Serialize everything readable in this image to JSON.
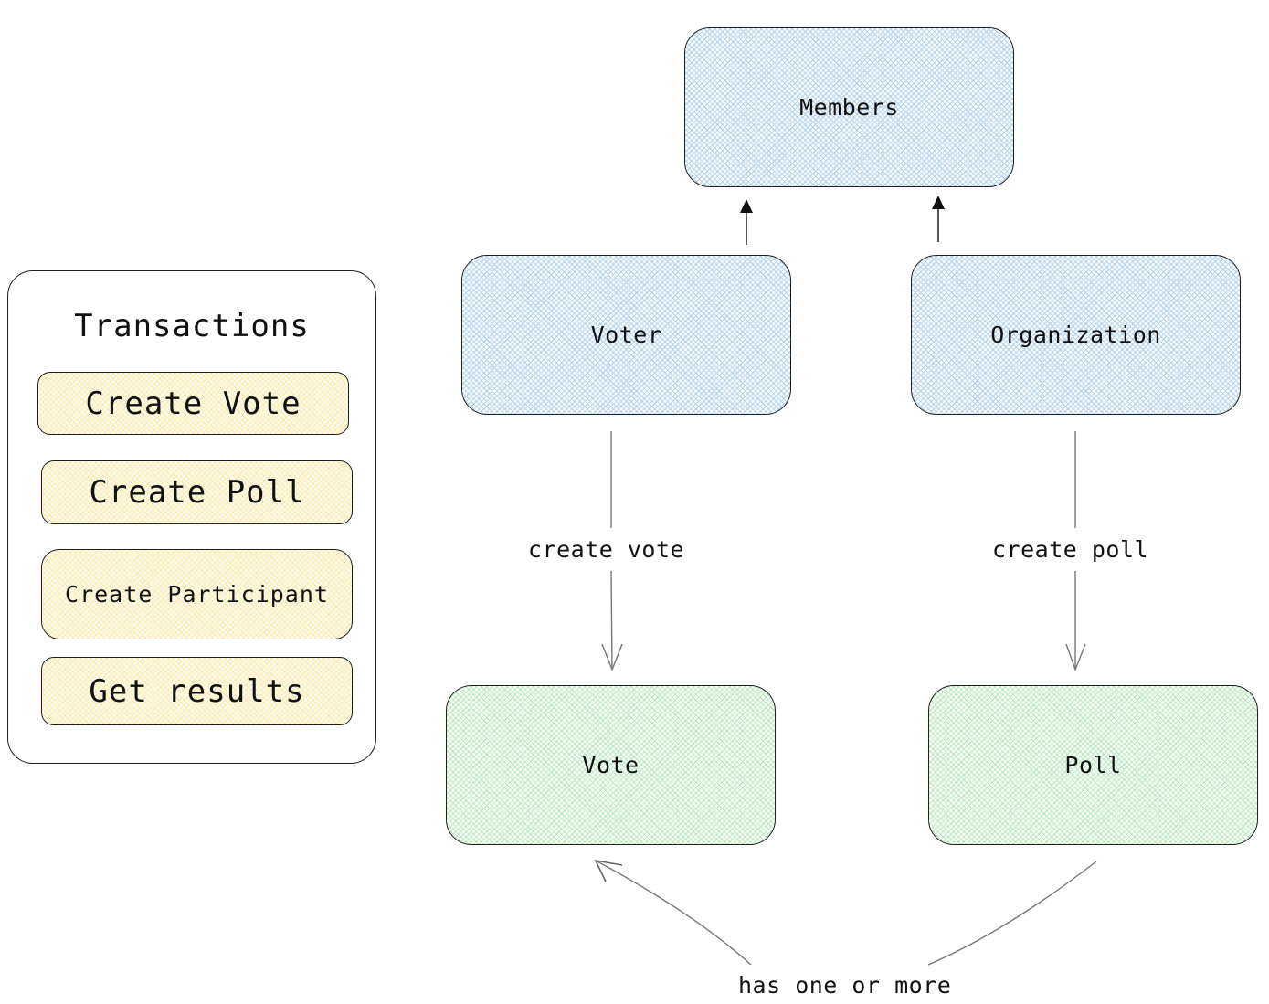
{
  "entities": {
    "members": {
      "label": "Members",
      "color": "#a5cdf0"
    },
    "voter": {
      "label": "Voter",
      "color": "#a5cdf0"
    },
    "organization": {
      "label": "Organization",
      "color": "#a5cdf0"
    },
    "vote": {
      "label": "Vote",
      "color": "#aae6af"
    },
    "poll": {
      "label": "Poll",
      "color": "#aae6af"
    }
  },
  "relations": {
    "voter_to_members": {
      "from": "Voter",
      "to": "Members",
      "type": "inherits"
    },
    "organization_to_members": {
      "from": "Organization",
      "to": "Members",
      "type": "inherits"
    },
    "create_vote": {
      "from": "Voter",
      "to": "Vote",
      "label": "create vote"
    },
    "create_poll": {
      "from": "Organization",
      "to": "Poll",
      "label": "create poll"
    },
    "has_one_or_more": {
      "from": "Poll",
      "to": "Vote",
      "label": "has one or more"
    }
  },
  "transactions": {
    "title": "Transactions",
    "color": "#fae496",
    "items": [
      {
        "label": "Create Vote"
      },
      {
        "label": "Create Poll"
      },
      {
        "label": "Create Participant"
      },
      {
        "label": "Get results"
      }
    ]
  }
}
